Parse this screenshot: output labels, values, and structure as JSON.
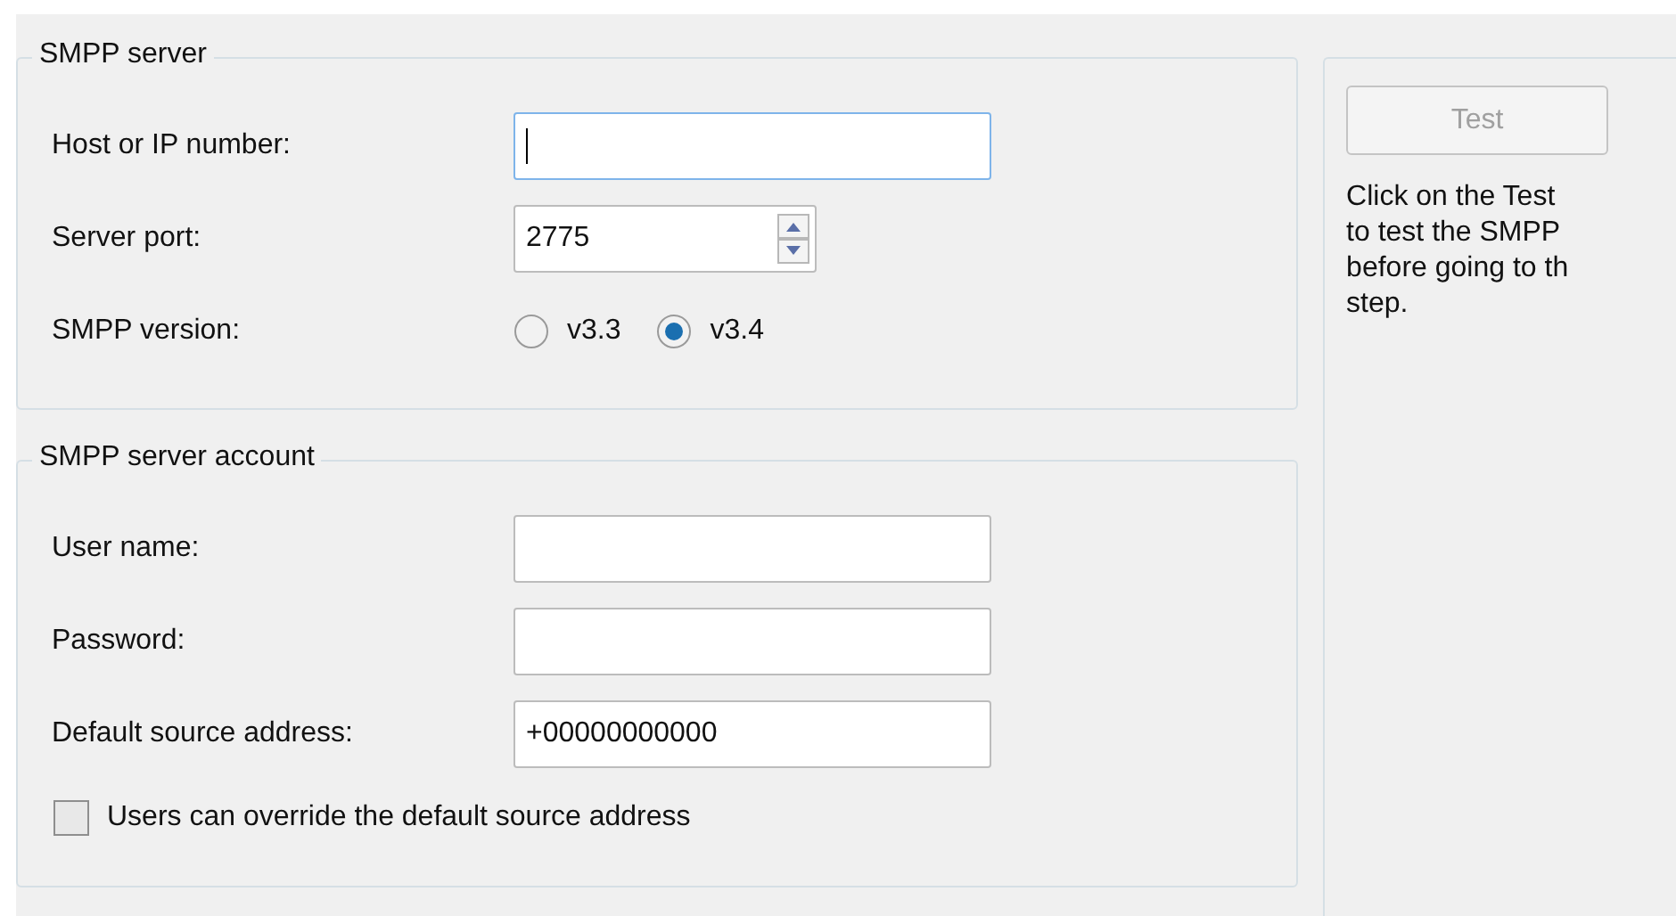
{
  "groups": [
    {
      "title": "SMPP server",
      "rows": [
        {
          "kind": "text",
          "label": "Host or IP number:",
          "focused": true
        },
        {
          "kind": "spin",
          "label": "Server port:",
          "value": "2775"
        },
        {
          "kind": "radio",
          "label": "SMPP version:",
          "options": [
            {
              "label": "v3.3",
              "selected": false
            },
            {
              "label": "v3.4",
              "selected": true
            }
          ]
        }
      ]
    },
    {
      "title": "SMPP server account",
      "rows": [
        {
          "kind": "text",
          "label": "User name:",
          "focused": false
        },
        {
          "kind": "text",
          "label": "Password:",
          "focused": false
        },
        {
          "kind": "text",
          "label": "Default source address:",
          "value": "+00000000000",
          "focused": false
        },
        {
          "kind": "check",
          "label": "Users can override the default source address",
          "checked": false
        }
      ]
    }
  ],
  "side": {
    "button": {
      "label": "Test",
      "disabled": true
    },
    "help_lines": [
      "Click on the Test",
      "to test the SMPP",
      "before going to th",
      "step."
    ]
  }
}
